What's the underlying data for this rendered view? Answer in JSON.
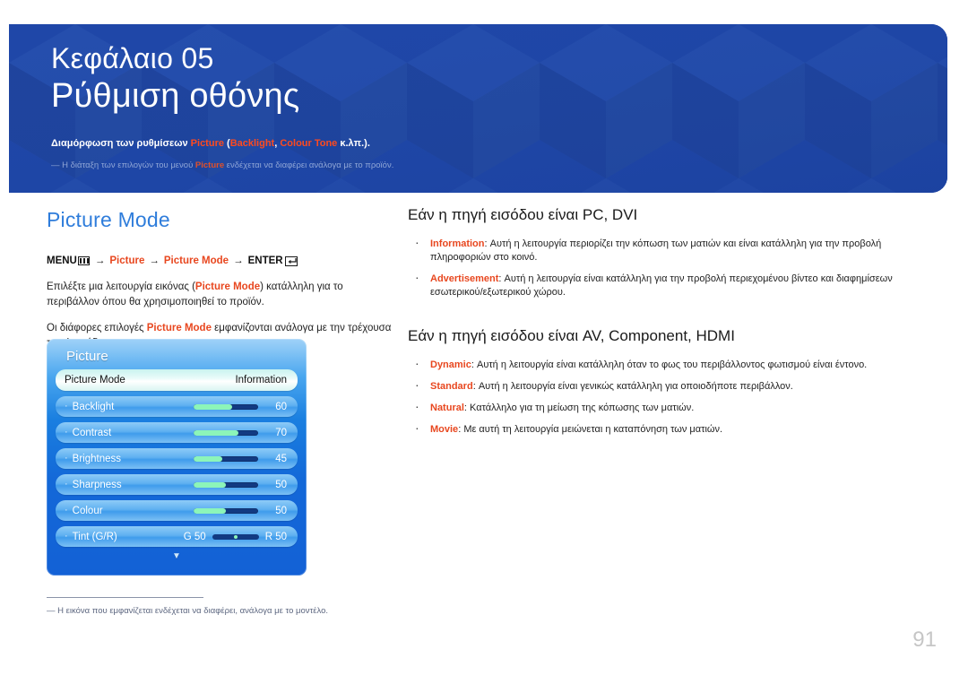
{
  "banner": {
    "chapter_label": "Κεφάλαιο 05",
    "chapter_title": "Ρύθμιση οθόνης",
    "subtitle_pre": "Διαμόρφωση των ρυθμίσεων ",
    "subtitle_hl1": "Picture",
    "subtitle_mid": " (",
    "subtitle_hl2": "Backlight",
    "subtitle_mid2": ", ",
    "subtitle_hl3": "Colour Tone",
    "subtitle_post": " κ.λπ.).",
    "note_dash": "―",
    "note_pre": " Η διάταξη των επιλογών του μενού ",
    "note_hl": "Picture",
    "note_post": " ενδέχεται να διαφέρει ανάλογα με το προϊόν.",
    "accent_red": "#ff4a1e",
    "background_blue": "#1f47a8"
  },
  "left": {
    "section_title": "Picture Mode",
    "menupath": {
      "menu_label": "MENU",
      "menu_icon": "menu-bars-icon",
      "arrow": "→",
      "step1": "Picture",
      "step2": "Picture Mode",
      "enter_label": "ENTER",
      "enter_icon": "enter-return-icon"
    },
    "paragraph1_pre": "Επιλέξτε μια λειτουργία εικόνας (",
    "paragraph1_hl": "Picture Mode",
    "paragraph1_post": ") κατάλληλη για το περιβάλλον όπου θα χρησιμοποιηθεί το προϊόν.",
    "paragraph2_pre": "Οι διάφορες επιλογές ",
    "paragraph2_hl": "Picture Mode",
    "paragraph2_post": " εμφανίζονται ανάλογα με την τρέχουσα πηγή εισόδου.",
    "footnote_dash": "―",
    "footnote": " Η εικόνα που εμφανίζεται ενδέχεται να διαφέρει, ανάλογα με το μοντέλο."
  },
  "osd": {
    "title": "Picture",
    "chevron": "▼",
    "rows": [
      {
        "label": "Picture Mode",
        "value": "Information",
        "type": "selected"
      },
      {
        "label": "Backlight",
        "value": "60",
        "type": "slider",
        "percent": 60
      },
      {
        "label": "Contrast",
        "value": "70",
        "type": "slider",
        "percent": 70
      },
      {
        "label": "Brightness",
        "value": "45",
        "type": "slider",
        "percent": 45
      },
      {
        "label": "Sharpness",
        "value": "50",
        "type": "slider",
        "percent": 50
      },
      {
        "label": "Colour",
        "value": "50",
        "type": "slider",
        "percent": 50
      },
      {
        "label": "Tint (G/R)",
        "type": "tint",
        "left_label": "G 50",
        "right_label": "R 50"
      }
    ]
  },
  "right": {
    "heading1": "Εάν η πηγή εισόδου είναι PC, DVI",
    "bullets1": [
      {
        "term": "Information",
        "sep": ": ",
        "text": "Αυτή η λειτουργία περιορίζει την κόπωση των ματιών και είναι κατάλληλη για την προβολή πληροφοριών στο κοινό."
      },
      {
        "term": "Advertisement",
        "sep": ": ",
        "text": "Αυτή η λειτουργία είναι κατάλληλη για την προβολή περιεχομένου βίντεο και διαφημίσεων εσωτερικού/εξωτερικού χώρου."
      }
    ],
    "heading2": "Εάν η πηγή εισόδου είναι AV, Component, HDMI",
    "bullets2": [
      {
        "term": "Dynamic",
        "sep": ": ",
        "text": "Αυτή η λειτουργία είναι κατάλληλη όταν το φως του περιβάλλοντος φωτισμού είναι έντονο."
      },
      {
        "term": "Standard",
        "sep": ": ",
        "text": "Αυτή η λειτουργία είναι γενικώς κατάλληλη για οποιοδήποτε περιβάλλον."
      },
      {
        "term": "Natural",
        "sep": ": ",
        "text": "Κατάλληλο για τη μείωση της κόπωσης των ματιών."
      },
      {
        "term": "Movie",
        "sep": ": ",
        "text": "Με αυτή τη λειτουργία μειώνεται η καταπόνηση των ματιών."
      }
    ]
  },
  "page_number": "91"
}
